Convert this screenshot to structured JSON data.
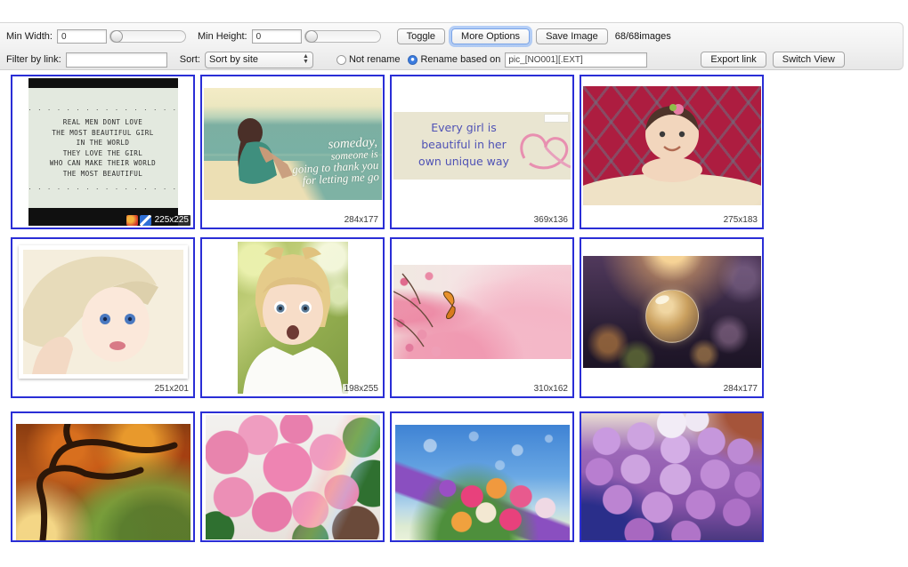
{
  "toolbar": {
    "min_width_label": "Min Width:",
    "min_width_value": "0",
    "min_height_label": "Min Height:",
    "min_height_value": "0",
    "toggle_label": "Toggle",
    "more_options_label": "More Options",
    "save_image_label": "Save Image",
    "count_text": "68/68images",
    "filter_label": "Filter by link:",
    "filter_value": "",
    "sort_label": "Sort:",
    "sort_value": "Sort by site",
    "not_rename_label": "Not rename",
    "rename_label": "Rename based on",
    "rename_pattern": "pic_[NO001][.EXT]",
    "export_link_label": "Export link",
    "switch_view_label": "Switch View"
  },
  "grid": {
    "tiles": [
      {
        "size": "225x225",
        "dotted": ". . . . . . . . . . . . . . . . . . .",
        "lines": [
          "REAL MEN DONT LOVE",
          "THE MOST BEAUTIFUL GIRL",
          "IN THE WORLD",
          "THEY LOVE THE GIRL",
          "WHO CAN MAKE THEIR WORLD",
          "THE MOST BEAUTIFUL"
        ]
      },
      {
        "size": "284x177",
        "lines": [
          "someday,",
          "someone is",
          "going to thank you",
          "for letting me go"
        ]
      },
      {
        "size": "369x136",
        "lines": [
          "Every girl is",
          "beautiful in her",
          "own unique way"
        ]
      },
      {
        "size": "275x183"
      },
      {
        "size": "251x201"
      },
      {
        "size": "198x255"
      },
      {
        "size": "310x162"
      },
      {
        "size": "284x177"
      },
      {
        "size": ""
      },
      {
        "size": ""
      },
      {
        "size": ""
      },
      {
        "size": ""
      }
    ]
  },
  "colors": {
    "tile_border": "#2a2ed6",
    "focus_ring": "#629bf5",
    "radio_selected": "#3b7ce0",
    "toolbar_bg": "#f1f1f1"
  }
}
